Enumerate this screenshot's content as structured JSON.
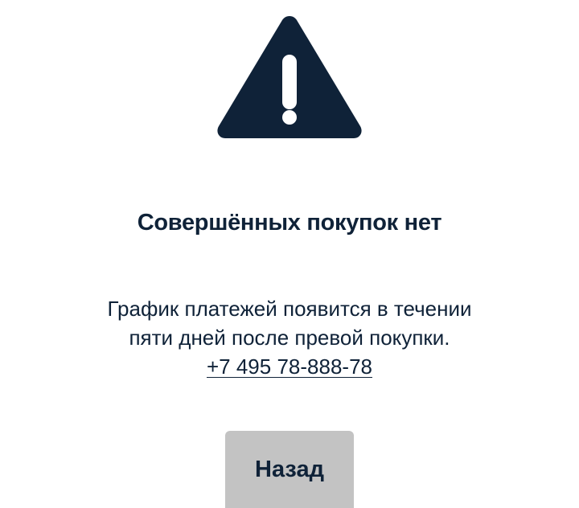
{
  "icon": {
    "name": "warning-icon",
    "color": "#0f2238"
  },
  "empty_state": {
    "title": "Совершённых покупок нет",
    "message_line1": "График платежей появится в течении",
    "message_line2": "пяти дней после превой покупки.",
    "phone": "+7 495 78-888-78"
  },
  "actions": {
    "back_label": "Назад",
    "back_color": "#c3c3c3"
  },
  "colors": {
    "text": "#0f2238",
    "background": "#ffffff"
  }
}
